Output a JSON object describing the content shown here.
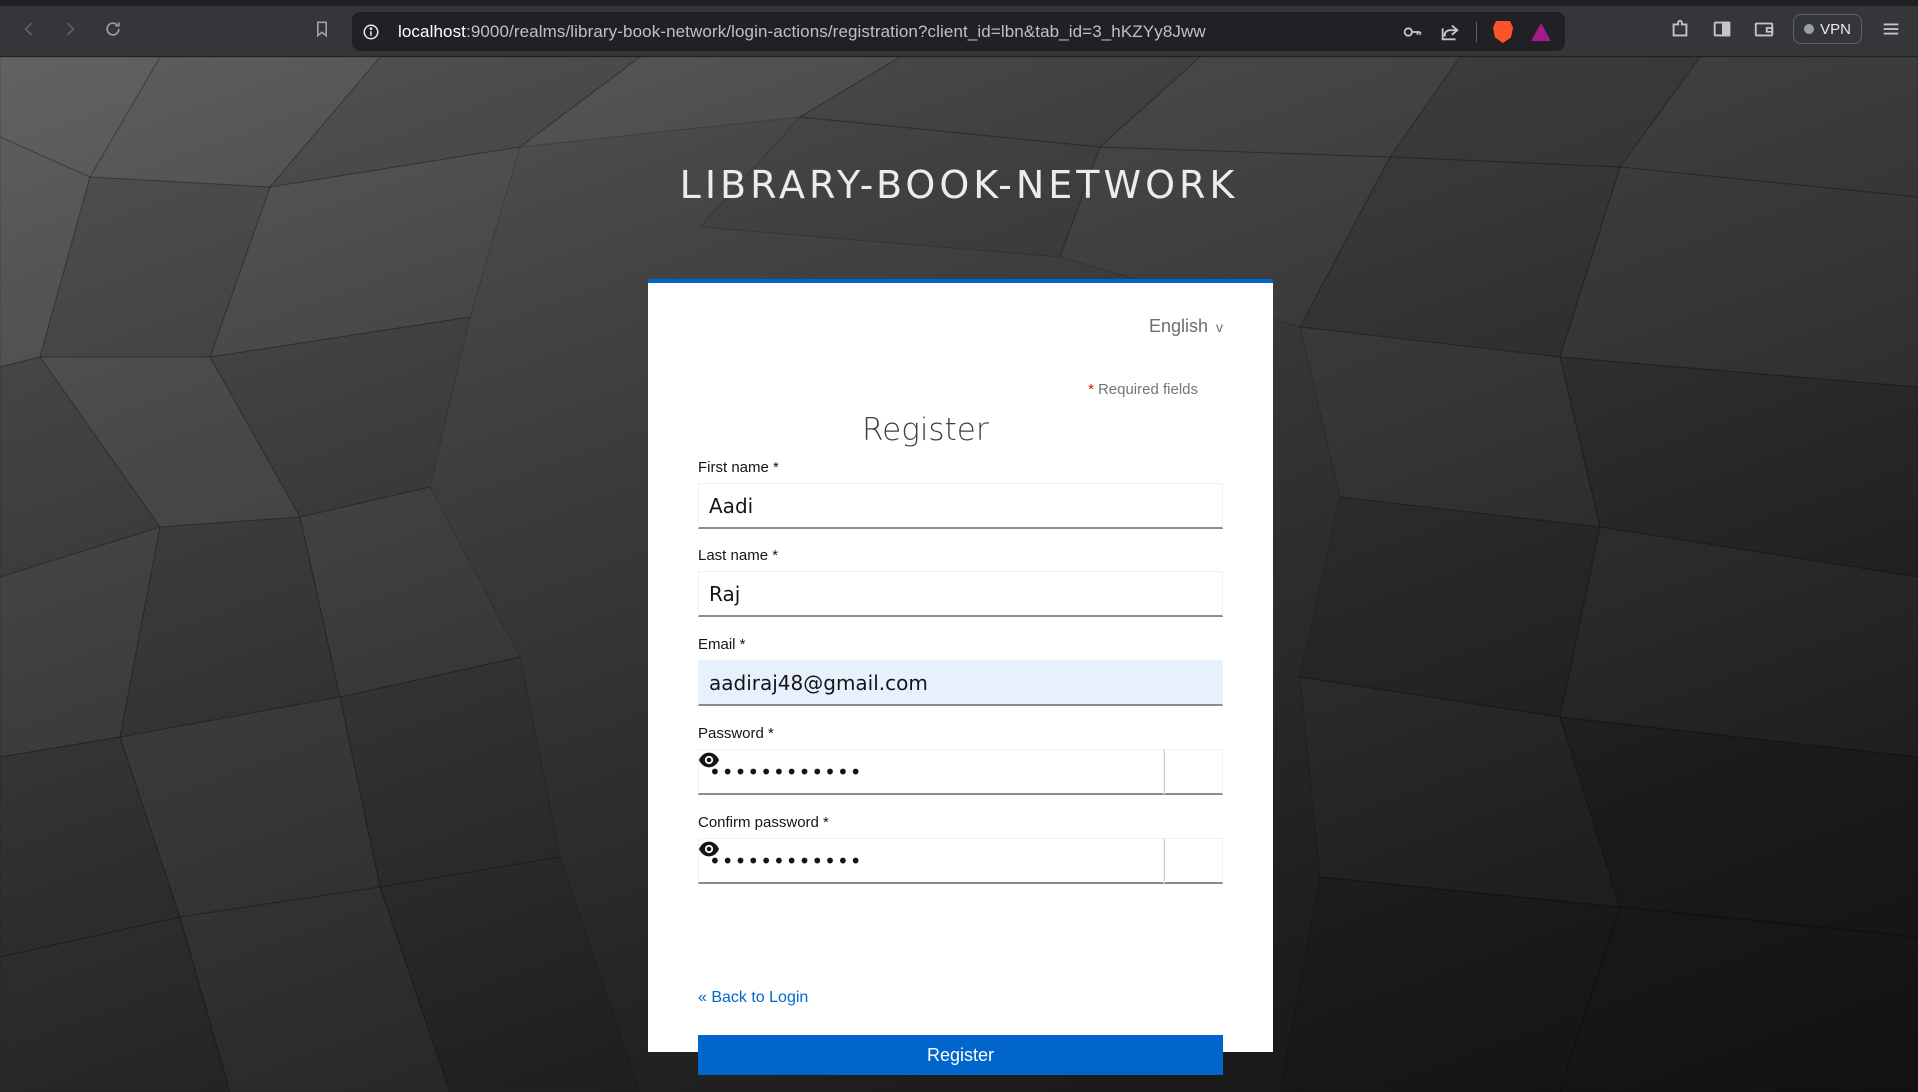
{
  "browser": {
    "url_host": "localhost",
    "url_rest": ":9000/realms/library-book-network/login-actions/registration?client_id=lbn&tab_id=3_hKZYy8Jww",
    "vpn_label": "VPN",
    "icons": [
      "back-icon",
      "forward-icon",
      "reload-icon",
      "bookmark-icon",
      "site-info-icon",
      "key-icon",
      "share-icon",
      "brave-shields-icon",
      "brave-rewards-icon",
      "extensions-icon",
      "sidebar-icon",
      "wallet-icon",
      "menu-icon"
    ]
  },
  "realm": {
    "title": "LIBRARY-BOOK-NETWORK"
  },
  "form": {
    "language": "English",
    "language_chevron": "v",
    "required_star": "*",
    "required_text": "Required fields",
    "title": "Register",
    "fields": {
      "first_name": {
        "label": "First name *",
        "value": "Aadi"
      },
      "last_name": {
        "label": "Last name *",
        "value": "Raj"
      },
      "email": {
        "label": "Email *",
        "value": "aadiraj48@gmail.com"
      },
      "password": {
        "label": "Password *",
        "value": "••••••••••••"
      },
      "confirm_password": {
        "label": "Confirm password *",
        "value": "••••••••••••"
      }
    },
    "back_link": "« Back to Login",
    "submit_label": "Register"
  },
  "colors": {
    "accent": "#0066cc",
    "autofill_bg": "#e8f0fe",
    "required_star": "#c9190b"
  }
}
